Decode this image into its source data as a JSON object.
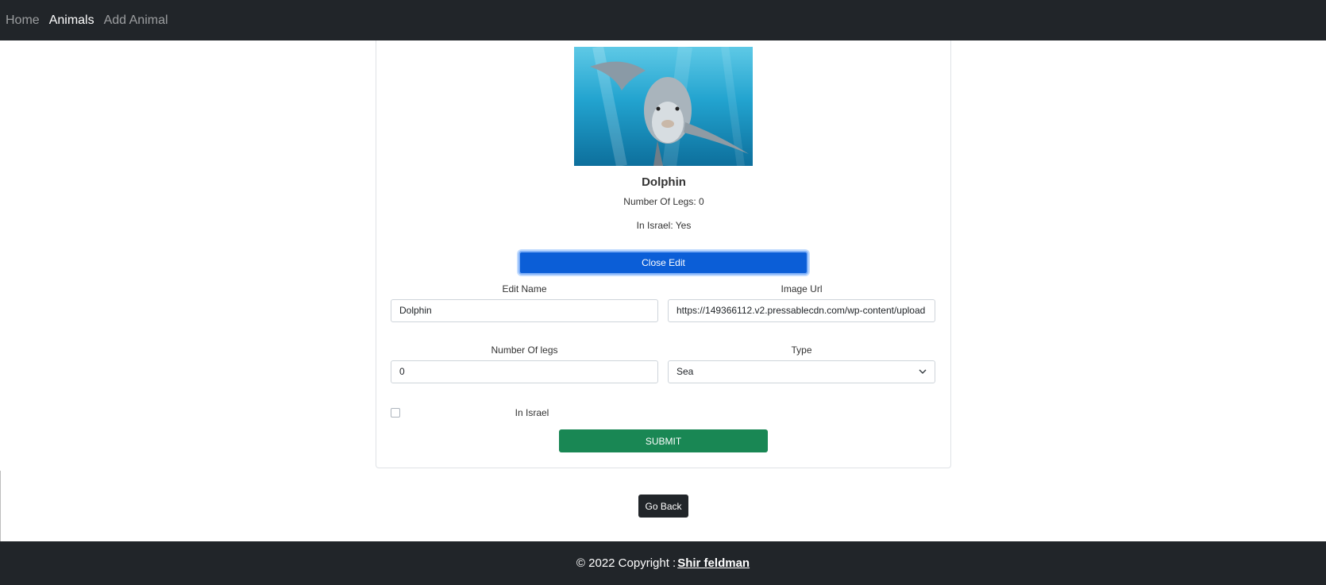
{
  "nav": {
    "items": [
      {
        "label": "Home",
        "active": false
      },
      {
        "label": "Animals",
        "active": true
      },
      {
        "label": "Add Animal",
        "active": false
      }
    ]
  },
  "animal": {
    "name": "Dolphin",
    "legs_text": "Number Of Legs: 0",
    "israel_text": "In Israel: Yes"
  },
  "buttons": {
    "close_edit": "Close Edit",
    "submit": "SUBMIT",
    "go_back": "Go Back"
  },
  "form": {
    "name_label": "Edit Name",
    "name_value": "Dolphin",
    "image_label": "Image Url",
    "image_value": "https://149366112.v2.pressablecdn.com/wp-content/upload",
    "legs_label": "Number Of legs",
    "legs_value": "0",
    "type_label": "Type",
    "type_value": "Sea",
    "israel_label": "In Israel",
    "israel_checked": false
  },
  "footer": {
    "copyright": "© 2022 Copyright :",
    "author": " Shir feldman"
  },
  "colors": {
    "navbar": "#212529",
    "primary": "#0b5ed7",
    "success": "#198754"
  }
}
